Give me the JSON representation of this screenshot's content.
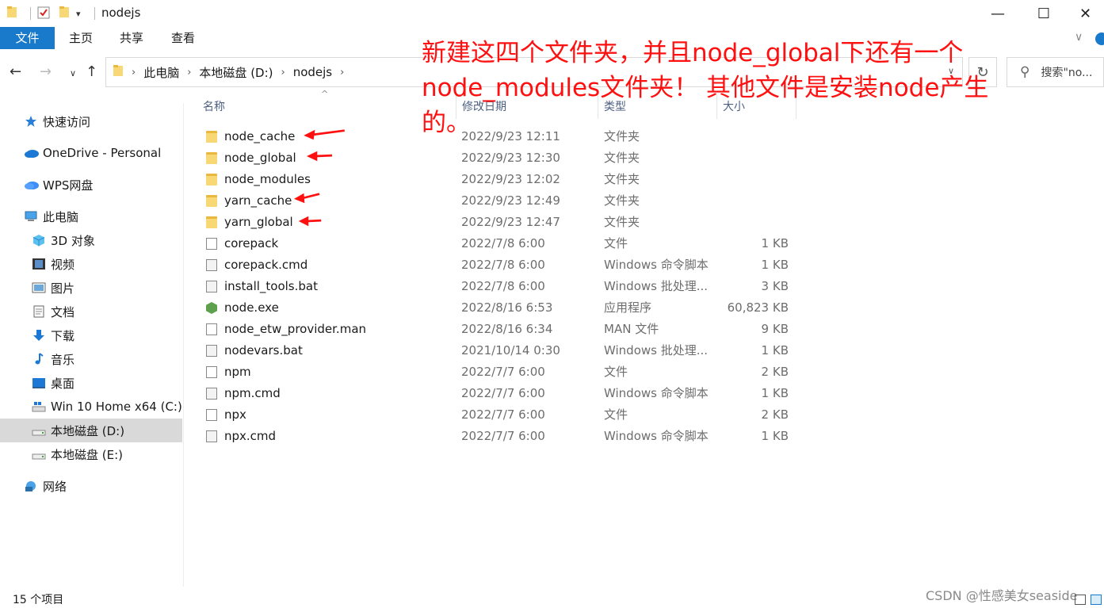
{
  "window": {
    "title": "nodejs",
    "controls": {
      "minimize": "—",
      "maximize": "☐",
      "close": "✕"
    }
  },
  "ribbon": {
    "tabs": [
      {
        "label": "文件"
      },
      {
        "label": "主页"
      },
      {
        "label": "共享"
      },
      {
        "label": "查看"
      }
    ]
  },
  "address": {
    "crumbs": [
      "此电脑",
      "本地磁盘 (D:)",
      "nodejs"
    ],
    "search_placeholder": "搜索\"no..."
  },
  "sidebar": {
    "items": [
      {
        "label": "快速访问",
        "icon": "star-icon"
      },
      {
        "label": "OneDrive - Personal",
        "icon": "cloud-icon"
      },
      {
        "label": "WPS网盘",
        "icon": "wps-cloud-icon"
      },
      {
        "label": "此电脑",
        "icon": "computer-icon"
      },
      {
        "label": "3D 对象",
        "icon": "cube-icon"
      },
      {
        "label": "视频",
        "icon": "video-icon"
      },
      {
        "label": "图片",
        "icon": "picture-icon"
      },
      {
        "label": "文档",
        "icon": "document-icon"
      },
      {
        "label": "下载",
        "icon": "download-icon"
      },
      {
        "label": "音乐",
        "icon": "music-icon"
      },
      {
        "label": "桌面",
        "icon": "desktop-icon"
      },
      {
        "label": "Win 10 Home x64 (C:)",
        "icon": "system-drive-icon"
      },
      {
        "label": "本地磁盘 (D:)",
        "icon": "drive-icon",
        "selected": true
      },
      {
        "label": "本地磁盘 (E:)",
        "icon": "drive-icon"
      },
      {
        "label": "网络",
        "icon": "network-icon"
      }
    ]
  },
  "columns": {
    "name": "名称",
    "date": "修改日期",
    "type": "类型",
    "size": "大小"
  },
  "files": [
    {
      "name": "node_cache",
      "date": "2022/9/23 12:11",
      "type": "文件夹",
      "size": "",
      "icon": "folder-icon"
    },
    {
      "name": "node_global",
      "date": "2022/9/23 12:30",
      "type": "文件夹",
      "size": "",
      "icon": "folder-icon"
    },
    {
      "name": "node_modules",
      "date": "2022/9/23 12:02",
      "type": "文件夹",
      "size": "",
      "icon": "folder-icon"
    },
    {
      "name": "yarn_cache",
      "date": "2022/9/23 12:49",
      "type": "文件夹",
      "size": "",
      "icon": "folder-icon"
    },
    {
      "name": "yarn_global",
      "date": "2022/9/23 12:47",
      "type": "文件夹",
      "size": "",
      "icon": "folder-icon"
    },
    {
      "name": "corepack",
      "date": "2022/7/8 6:00",
      "type": "文件",
      "size": "1 KB",
      "icon": "file-icon"
    },
    {
      "name": "corepack.cmd",
      "date": "2022/7/8 6:00",
      "type": "Windows 命令脚本",
      "size": "1 KB",
      "icon": "script-icon"
    },
    {
      "name": "install_tools.bat",
      "date": "2022/7/8 6:00",
      "type": "Windows 批处理...",
      "size": "3 KB",
      "icon": "script-icon"
    },
    {
      "name": "node.exe",
      "date": "2022/8/16 6:53",
      "type": "应用程序",
      "size": "60,823 KB",
      "icon": "node-exe-icon"
    },
    {
      "name": "node_etw_provider.man",
      "date": "2022/8/16 6:34",
      "type": "MAN 文件",
      "size": "9 KB",
      "icon": "file-icon"
    },
    {
      "name": "nodevars.bat",
      "date": "2021/10/14 0:30",
      "type": "Windows 批处理...",
      "size": "1 KB",
      "icon": "script-icon"
    },
    {
      "name": "npm",
      "date": "2022/7/7 6:00",
      "type": "文件",
      "size": "2 KB",
      "icon": "file-icon"
    },
    {
      "name": "npm.cmd",
      "date": "2022/7/7 6:00",
      "type": "Windows 命令脚本",
      "size": "1 KB",
      "icon": "script-icon"
    },
    {
      "name": "npx",
      "date": "2022/7/7 6:00",
      "type": "文件",
      "size": "2 KB",
      "icon": "file-icon"
    },
    {
      "name": "npx.cmd",
      "date": "2022/7/7 6:00",
      "type": "Windows 命令脚本",
      "size": "1 KB",
      "icon": "script-icon"
    }
  ],
  "annotation": {
    "text": "新建这四个文件夹，并且node_global下还有一个node_modules文件夹！ 其他文件是安装node产生的。",
    "color": "#ff1010"
  },
  "status": {
    "count": "15 个项目"
  },
  "watermark": "CSDN @性感美女seaside",
  "colors": {
    "accent": "#1979ca",
    "selected_bg": "#d9d9d9",
    "folder": "#f8d775"
  }
}
